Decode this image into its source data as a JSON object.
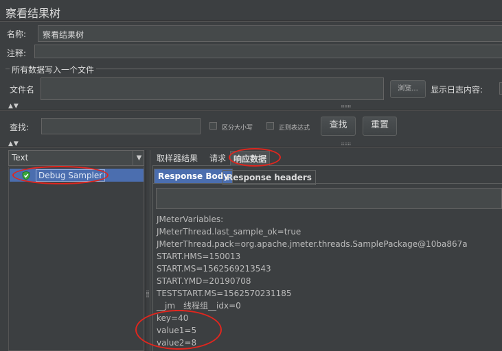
{
  "window": {
    "title": "察看结果树"
  },
  "name_row": {
    "label": "名称:",
    "value": "察看结果树"
  },
  "comment_row": {
    "label": "注释:",
    "value": ""
  },
  "file_group": {
    "title": "所有数据写入一个文件",
    "filename_label": "文件名",
    "filename_value": "",
    "browse_label": "浏览...",
    "log_label": "显示日志内容:"
  },
  "search": {
    "label": "查找:",
    "value": "",
    "case_label": "区分大小写",
    "regex_label": "正则表达式",
    "search_button": "查找",
    "reset_button": "重置"
  },
  "tree": {
    "renderer": "Text",
    "items": [
      {
        "label": "Debug Sampler",
        "status": "success"
      }
    ]
  },
  "result_tabs": [
    "取样器结果",
    "请求",
    "响应数据"
  ],
  "active_result_tab": "响应数据",
  "sub_tabs": [
    "Response Body",
    "Response headers"
  ],
  "active_sub_tab": "Response Body",
  "response_lines": [
    "JMeterVariables:",
    "JMeterThread.last_sample_ok=true",
    "JMeterThread.pack=org.apache.jmeter.threads.SamplePackage@10ba867a",
    "START.HMS=150013",
    "START.MS=1562569213543",
    "START.YMD=20190708",
    "TESTSTART.MS=1562570231185",
    "__jm__线程组__idx=0",
    "key=40",
    "value1=5",
    "value2=8"
  ],
  "highlight_color": "#e0261e",
  "icons": {
    "success": "green-check-shield-icon",
    "dropdown": "triangle-down-icon",
    "collapse": "double-arrow-icon",
    "grip": "drag-grip-icon"
  }
}
